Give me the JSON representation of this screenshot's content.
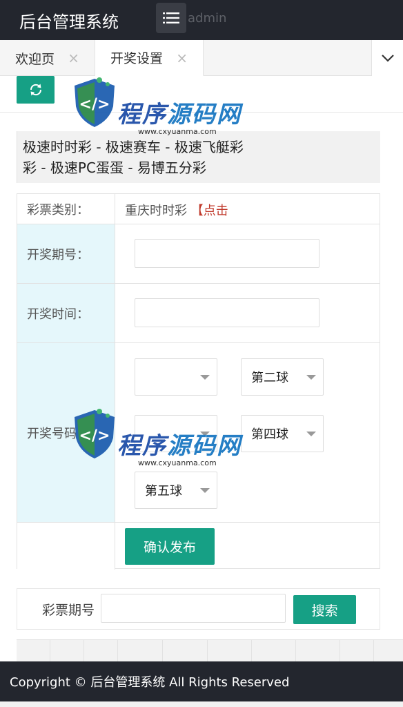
{
  "header": {
    "logo": "后台管理系统",
    "user": "admin"
  },
  "tabs": [
    {
      "label": "欢迎页",
      "close": "×"
    },
    {
      "label": "开奖设置",
      "close": "×"
    }
  ],
  "lottery_types": {
    "line1": "极速时时彩 - 极速赛车 - 极速飞艇彩",
    "line2": "彩 - 极速PC蛋蛋 - 易博五分彩"
  },
  "form": {
    "category_label": "彩票类别：",
    "category_value": "重庆时时彩",
    "category_click": "【点击",
    "period_label": "开奖期号：",
    "time_label": "开奖时间：",
    "number_label": "开奖号码",
    "selects": {
      "ball2": "第二球",
      "ball4": "第四球",
      "ball5": "第五球"
    },
    "submit": "确认发布"
  },
  "search": {
    "label": "彩票期号",
    "button": "搜索"
  },
  "watermark": {
    "text_a": "程序",
    "text_b": "源码网",
    "url": "www.cxyuanma.com"
  },
  "footer": {
    "text": "Copyright © 后台管理系统 All Rights Reserved"
  },
  "colors": {
    "header": "#23262e",
    "accent": "#16a085",
    "label_bg": "#e5f7fb"
  }
}
